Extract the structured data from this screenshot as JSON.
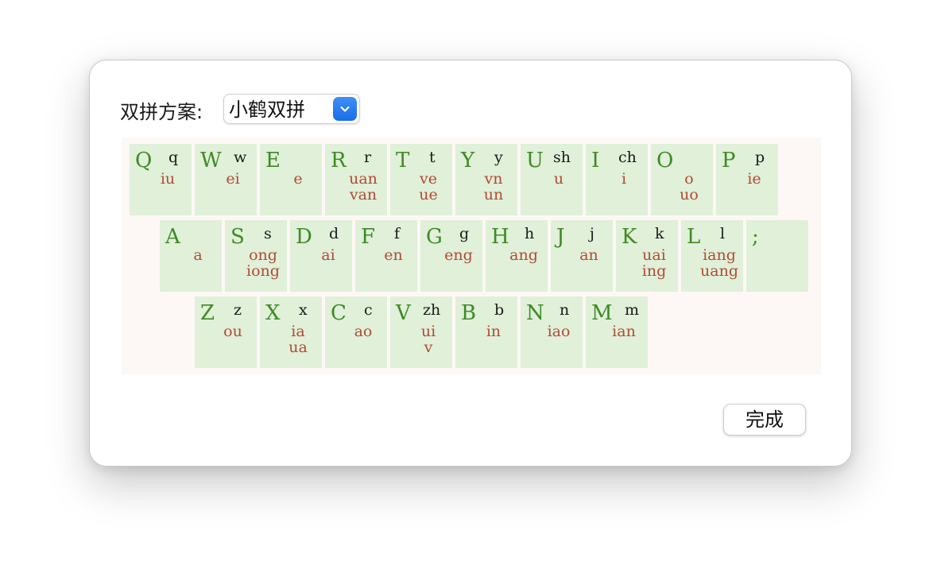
{
  "dialog": {
    "scheme_label": "双拼方案:",
    "scheme_select": {
      "value": "小鹤双拼",
      "chevron_icon": "chevron-down-icon",
      "accent_color": "#1a6ee8"
    },
    "done_label": "完成"
  },
  "keyboard": {
    "colors": {
      "key_bg": "#e0f0d9",
      "keyboard_bg": "#fdf8f5",
      "upper": "#3f8a25",
      "lower": "#1a1a1a",
      "finals": "#b24a35"
    },
    "rows": [
      [
        {
          "upper": "Q",
          "lower": "q",
          "finals": [
            "iu"
          ]
        },
        {
          "upper": "W",
          "lower": "w",
          "finals": [
            "ei"
          ]
        },
        {
          "upper": "E",
          "lower": "",
          "finals": [
            "e"
          ]
        },
        {
          "upper": "R",
          "lower": "r",
          "finals": [
            "uan",
            "van"
          ]
        },
        {
          "upper": "T",
          "lower": "t",
          "finals": [
            "ve",
            "ue"
          ]
        },
        {
          "upper": "Y",
          "lower": "y",
          "finals": [
            "vn",
            "un"
          ]
        },
        {
          "upper": "U",
          "lower": "sh",
          "finals": [
            "u"
          ]
        },
        {
          "upper": "I",
          "lower": "ch",
          "finals": [
            "i"
          ]
        },
        {
          "upper": "O",
          "lower": "",
          "finals": [
            "o",
            "uo"
          ]
        },
        {
          "upper": "P",
          "lower": "p",
          "finals": [
            "ie"
          ]
        }
      ],
      [
        {
          "upper": "A",
          "lower": "",
          "finals": [
            "a"
          ]
        },
        {
          "upper": "S",
          "lower": "s",
          "finals": [
            "ong",
            "iong"
          ]
        },
        {
          "upper": "D",
          "lower": "d",
          "finals": [
            "ai"
          ]
        },
        {
          "upper": "F",
          "lower": "f",
          "finals": [
            "en"
          ]
        },
        {
          "upper": "G",
          "lower": "g",
          "finals": [
            "eng"
          ]
        },
        {
          "upper": "H",
          "lower": "h",
          "finals": [
            "ang"
          ]
        },
        {
          "upper": "J",
          "lower": "j",
          "finals": [
            "an"
          ]
        },
        {
          "upper": "K",
          "lower": "k",
          "finals": [
            "uai",
            "ing"
          ]
        },
        {
          "upper": "L",
          "lower": "l",
          "finals": [
            "iang",
            "uang"
          ]
        },
        {
          "upper": ";",
          "lower": "",
          "finals": []
        }
      ],
      [
        {
          "upper": "Z",
          "lower": "z",
          "finals": [
            "ou"
          ]
        },
        {
          "upper": "X",
          "lower": "x",
          "finals": [
            "ia",
            "ua"
          ]
        },
        {
          "upper": "C",
          "lower": "c",
          "finals": [
            "ao"
          ]
        },
        {
          "upper": "V",
          "lower": "zh",
          "finals": [
            "ui",
            "v"
          ]
        },
        {
          "upper": "B",
          "lower": "b",
          "finals": [
            "in"
          ]
        },
        {
          "upper": "N",
          "lower": "n",
          "finals": [
            "iao"
          ]
        },
        {
          "upper": "M",
          "lower": "m",
          "finals": [
            "ian"
          ]
        }
      ]
    ]
  }
}
